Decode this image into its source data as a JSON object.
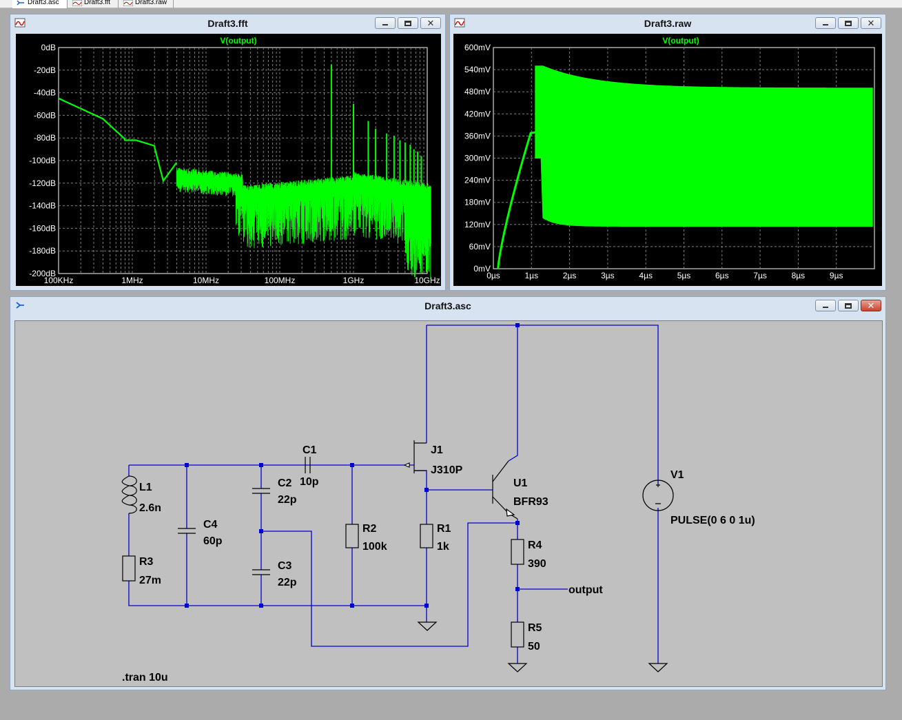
{
  "tabs": [
    {
      "label": "Draft3.asc",
      "active": true
    },
    {
      "label": "Draft3.fft",
      "active": false
    },
    {
      "label": "Draft3.raw",
      "active": false
    }
  ],
  "fft_window": {
    "title": "Draft3.fft",
    "trace": "V(output)",
    "y_ticks": [
      "0dB",
      "-20dB",
      "-40dB",
      "-60dB",
      "-80dB",
      "-100dB",
      "-120dB",
      "-140dB",
      "-160dB",
      "-180dB",
      "-200dB"
    ],
    "x_ticks": [
      "100KHz",
      "1MHz",
      "10MHz",
      "100MHz",
      "1GHz",
      "10GHz"
    ]
  },
  "raw_window": {
    "title": "Draft3.raw",
    "trace": "V(output)",
    "y_ticks": [
      "600mV",
      "540mV",
      "480mV",
      "420mV",
      "360mV",
      "300mV",
      "240mV",
      "180mV",
      "120mV",
      "60mV",
      "0mV"
    ],
    "x_ticks": [
      "0µs",
      "1µs",
      "2µs",
      "3µs",
      "4µs",
      "5µs",
      "6µs",
      "7µs",
      "8µs",
      "9µs"
    ]
  },
  "schematic_window": {
    "title": "Draft3.asc",
    "components": {
      "L1": {
        "name": "L1",
        "value": "2.6n"
      },
      "R3": {
        "name": "R3",
        "value": "27m"
      },
      "C4": {
        "name": "C4",
        "value": "60p"
      },
      "C2": {
        "name": "C2",
        "value": "22p"
      },
      "C3": {
        "name": "C3",
        "value": "22p"
      },
      "C1": {
        "name": "C1",
        "value": "10p"
      },
      "R2": {
        "name": "R2",
        "value": "100k"
      },
      "J1": {
        "name": "J1",
        "value": "J310P"
      },
      "R1": {
        "name": "R1",
        "value": "1k"
      },
      "U1": {
        "name": "U1",
        "value": "BFR93"
      },
      "R4": {
        "name": "R4",
        "value": "390"
      },
      "R5": {
        "name": "R5",
        "value": "50"
      },
      "V1": {
        "name": "V1",
        "value": "PULSE(0 6 0 1u)"
      }
    },
    "net_label": "output",
    "directive": ".tran 10u"
  },
  "colors": {
    "trace": "#00ff00",
    "wire": "#0000cc",
    "grid": "#808080",
    "plot_bg": "#000000",
    "schematic_bg": "#c0c0c0"
  },
  "icons": {
    "plot_window": "waveform-icon",
    "schematic_window": "schematic-icon"
  }
}
